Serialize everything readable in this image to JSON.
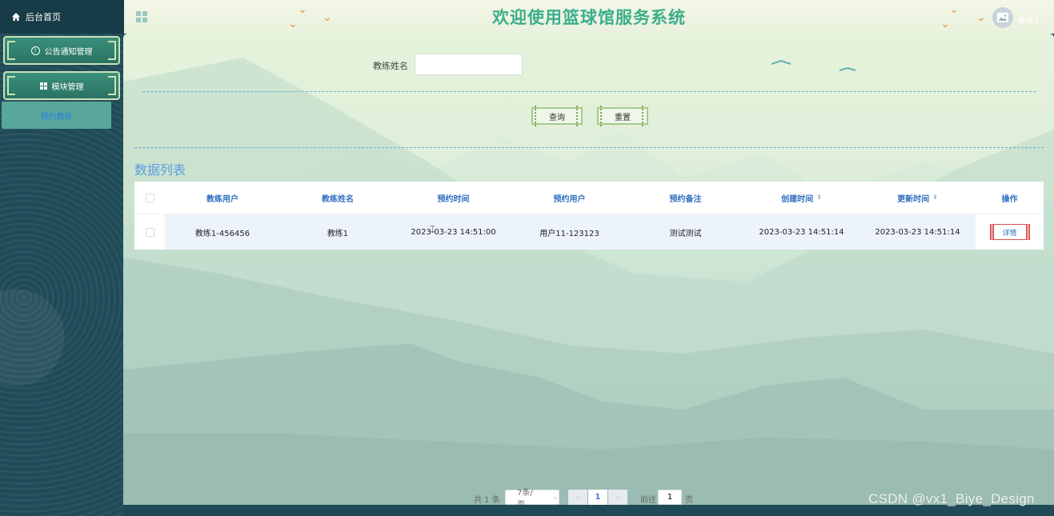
{
  "header": {
    "home_label": "后台首页",
    "title": "欢迎使用篮球馆服务系统",
    "user_name": "教练1"
  },
  "sidebar": {
    "items": [
      {
        "label": "公告通知管理",
        "icon": "info-circle-icon"
      },
      {
        "label": "模块管理",
        "icon": "grid-icon"
      }
    ],
    "sub_item": "预约教练"
  },
  "search": {
    "label": "教练姓名",
    "value": "",
    "placeholder": "",
    "query_button": "查询",
    "reset_button": "重置"
  },
  "list": {
    "title": "数据列表",
    "columns": [
      "教练用户",
      "教练姓名",
      "预约时间",
      "预约用户",
      "预约备注",
      "创建时间",
      "更新时间",
      "操作"
    ],
    "rows": [
      {
        "coach_user": "教练1-456456",
        "coach_name": "教练1",
        "booking_time": "2023-03-23 14:51:00",
        "booking_user": "用户11-123123",
        "remark": "测试测试",
        "created": "2023-03-23 14:51:14",
        "updated": "2023-03-23 14:51:14",
        "action": "详情"
      }
    ]
  },
  "pagination": {
    "total": "共 1 条",
    "page_size": "7条/页",
    "current_page": "1",
    "goto_label": "前往",
    "goto_value": "1",
    "page_suffix": "页"
  },
  "watermark": "CSDN @vx1_Biye_Design",
  "colors": {
    "title": "#3bae8c",
    "sidebar_bg": "#1f4a57",
    "header_text": "#2f6fbf",
    "section_title": "#5a9ce0",
    "detail_border": "#d9534f"
  }
}
